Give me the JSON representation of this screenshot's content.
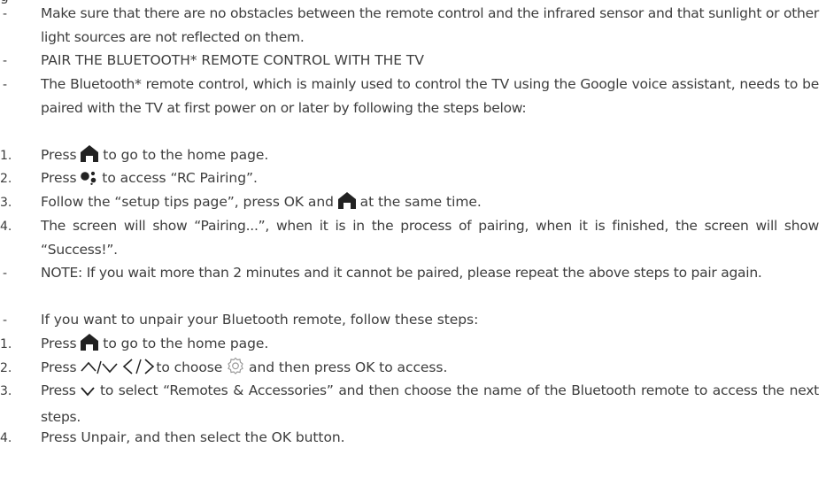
{
  "top_fragment": "g",
  "items": [
    {
      "marker": "-",
      "parts": [
        "Make sure that there are no obstacles between the remote control and the infrared sensor and that sunlight or other light sources are not reflected on them."
      ]
    },
    {
      "marker": "-",
      "parts": [
        "PAIR THE BLUETOOTH* REMOTE CONTROL WITH THE TV"
      ]
    },
    {
      "marker": "-",
      "parts": [
        "The Bluetooth* remote control, which is mainly used to control the TV using the Google voice assistant, needs to be paired with the TV at first power on or later by following the steps below:"
      ]
    },
    {
      "marker": "1.",
      "parts": [
        "Press ",
        " to go to the home page."
      ],
      "icons": [
        "home-icon"
      ]
    },
    {
      "marker": "2.",
      "parts": [
        "Press ",
        " to access “RC Pairing”."
      ],
      "icons": [
        "google-assistant-icon"
      ]
    },
    {
      "marker": "3.",
      "parts": [
        "Follow the “setup tips page”, press OK and ",
        " at the same time."
      ],
      "icons": [
        "home-icon"
      ]
    },
    {
      "marker": "4.",
      "parts": [
        "The screen will show “Pairing...”, when it is in the process of pairing, when it is finished, the screen will show “Success!”."
      ]
    },
    {
      "marker": "-",
      "parts": [
        "NOTE:  If you wait more than 2 minutes and it cannot be paired, please repeat the above steps to pair again."
      ]
    },
    {
      "marker": "-",
      "parts": [
        "If you want to unpair your Bluetooth remote, follow these steps:"
      ]
    },
    {
      "marker": "1.",
      "parts": [
        "Press ",
        " to go to the home page."
      ],
      "icons": [
        "home-icon"
      ]
    },
    {
      "marker": "2.",
      "parts": [
        "Press ",
        " ",
        "to choose ",
        " and then press OK to access."
      ],
      "icons": [
        "up-down-arrows-icon",
        "left-right-arrows-icon",
        "settings-gear-icon"
      ]
    },
    {
      "marker": "3.",
      "parts": [
        "Press ",
        " to select “Remotes & Accessories” and then choose the name of the Bluetooth remote to access the next steps."
      ],
      "icons": [
        "down-arrow-icon"
      ]
    },
    {
      "marker": "4.",
      "parts": [
        "Press Unpair, and then select the OK button."
      ]
    }
  ],
  "colors": {
    "text": "#3d3d3d",
    "icon": "#222222",
    "icon_light": "#9a9a9a"
  }
}
